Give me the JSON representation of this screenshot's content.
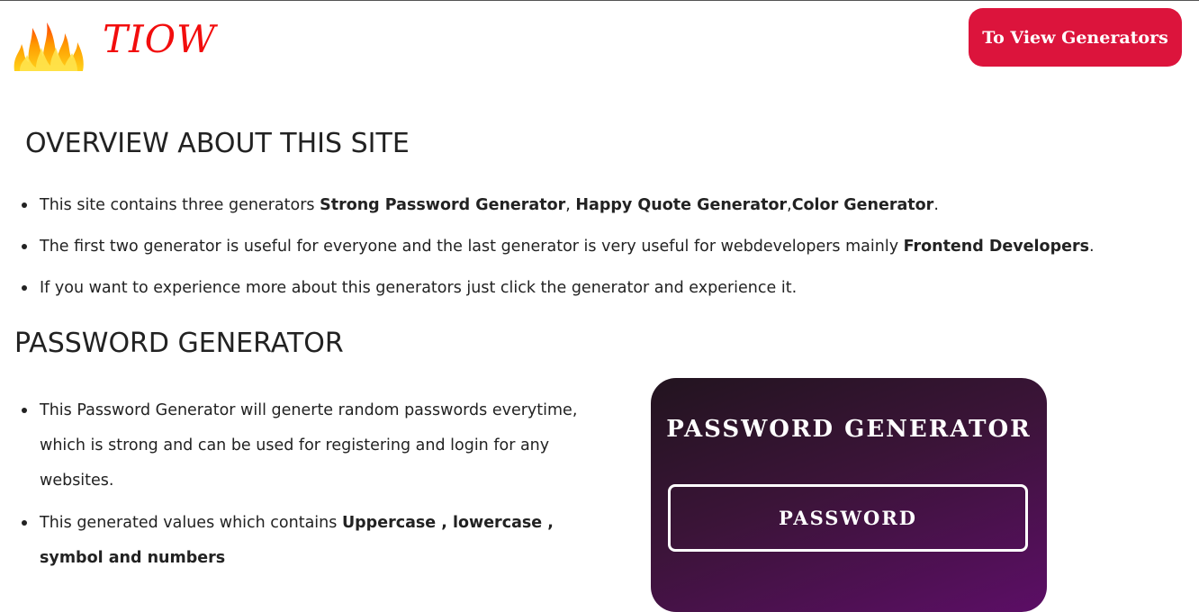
{
  "header": {
    "brand": "TIOW",
    "cta_label": "To View Generators",
    "logo_icon": "fire-icon"
  },
  "overview": {
    "heading": "OVERVIEW ABOUT THIS SITE",
    "items": [
      {
        "t1": "This site contains three generators ",
        "b1": "Strong Password Generator",
        "t2": ", ",
        "b2": "Happy Quote Generator",
        "t3": ",",
        "b3": "Color Generator",
        "t4": "."
      },
      {
        "t1": "The first two generator is useful for everyone and the last generator is very useful for webdevelopers mainly ",
        "b1": "Frontend Developers",
        "t2": "."
      },
      {
        "t1": "If you want to experience more about this generators just click the generator and experience it."
      }
    ]
  },
  "password_section": {
    "heading": "PASSWORD GENERATOR",
    "items": [
      {
        "t1": "This Password Generator will generte random passwords everytime, which is strong and can be used for registering and login for any websites."
      },
      {
        "t1": "This generated values which contains ",
        "b1": "Uppercase , lowercase , symbol and numbers"
      }
    ],
    "card": {
      "title": "PASSWORD GENERATOR",
      "output_label": "PASSWORD"
    }
  },
  "colors": {
    "brand": "#f20d0d",
    "cta_bg": "#dc143c",
    "card_gradient_start": "#22141f",
    "card_gradient_end": "#5c0e66"
  }
}
